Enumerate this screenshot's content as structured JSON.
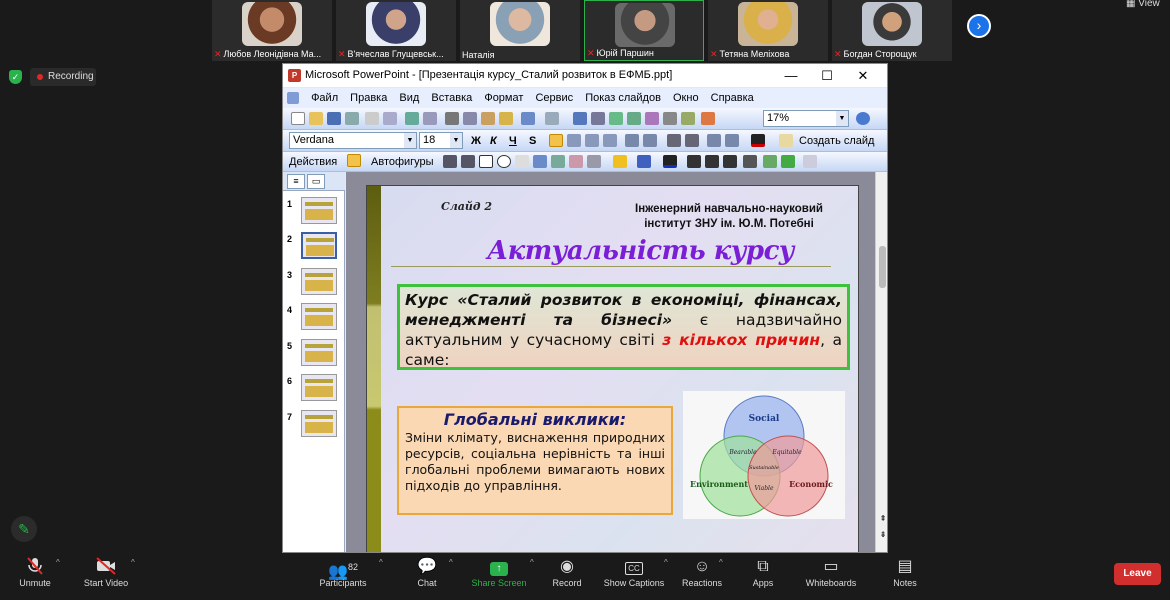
{
  "meeting": {
    "participants": [
      {
        "name": "Любов Леонідівна Ма..."
      },
      {
        "name": "В'ячеслав Глущевськ..."
      },
      {
        "name": "Наталія"
      },
      {
        "name": "Юрій Паршин"
      },
      {
        "name": "Тетяна Меліхова"
      },
      {
        "name": "Богдан Сторощук"
      }
    ],
    "view_label": "View",
    "recording_label": "Recording",
    "toolbar": {
      "unmute": "Unmute",
      "start_video": "Start Video",
      "participants": "Participants",
      "participants_count": "82",
      "chat": "Chat",
      "share_screen": "Share Screen",
      "record": "Record",
      "show_captions": "Show Captions",
      "captions_badge": "CC",
      "reactions": "Reactions",
      "apps": "Apps",
      "whiteboards": "Whiteboards",
      "notes": "Notes",
      "leave": "Leave"
    }
  },
  "ppt": {
    "window_title": "Microsoft PowerPoint - [Презентація курсу_Сталий розвиток в ЕФМБ.ppt]",
    "menu": [
      "Файл",
      "Правка",
      "Вид",
      "Вставка",
      "Формат",
      "Сервис",
      "Показ слайдов",
      "Окно",
      "Справка"
    ],
    "zoom": "17%",
    "font_name": "Verdana",
    "font_size": "18",
    "format_buttons": {
      "bold": "Ж",
      "italic": "К",
      "underline": "Ч",
      "shadow": "S"
    },
    "create_slide": "Создать слайд",
    "actions": "Действия",
    "autoshapes": "Автофигуры",
    "thumbnails": [
      "1",
      "2",
      "3",
      "4",
      "5",
      "6",
      "7"
    ],
    "selected_slide": 2
  },
  "slide": {
    "slide_no": "Слайд 2",
    "institute_line1": "Інженерний навчально-науковий",
    "institute_line2": "інститут ЗНУ ім. Ю.М. Потебні",
    "title": "Актуальність курсу",
    "course_intro_bold": "Курс «Сталий розвиток в економіці, фінансах, менеджменті та бізнесі»",
    "course_intro_rest": " є надзвичайно актуальним у сучасному світі ",
    "course_intro_red": "з кількох причин",
    "course_intro_end": ", а саме:",
    "global_heading": "Глобальні виклики",
    "global_colon": ":",
    "global_text": " Зміни клімату, виснаження природних ресурсів, соціальна нерівність та інші глобальні проблеми вимагають нових підходів до управління.",
    "venn": {
      "social": "Social",
      "environment": "Environment",
      "economic": "Economic",
      "bearable": "Bearable",
      "equitable": "Equitable",
      "viable": "Viable",
      "sustainable": "Sustainable"
    }
  }
}
